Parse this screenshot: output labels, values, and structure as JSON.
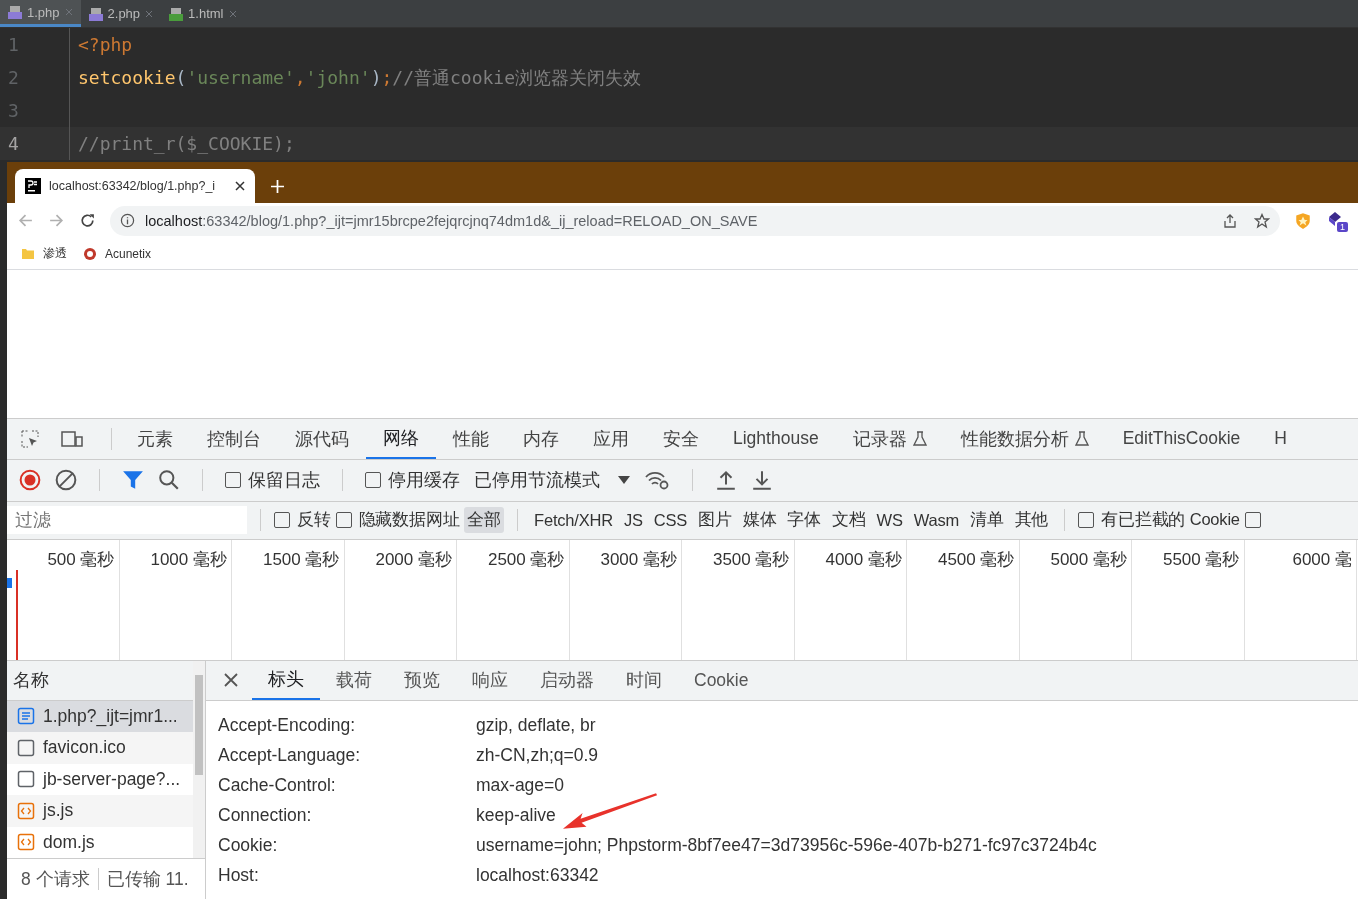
{
  "editor_tabs": [
    {
      "label": "1.php",
      "kind": "php",
      "selected": true
    },
    {
      "label": "2.php",
      "kind": "php",
      "selected": false
    },
    {
      "label": "1.html",
      "kind": "html",
      "selected": false
    }
  ],
  "code_lines": [
    {
      "number": "1",
      "current": false,
      "tokens": [
        {
          "kind": "keyword",
          "text": "<?php"
        }
      ]
    },
    {
      "number": "2",
      "current": false,
      "tokens": [
        {
          "kind": "function",
          "text": "setcookie"
        },
        {
          "kind": "punct",
          "text": "("
        },
        {
          "kind": "string",
          "text": "'username'"
        },
        {
          "kind": "keyword",
          "text": ","
        },
        {
          "kind": "string",
          "text": "'john'"
        },
        {
          "kind": "punct",
          "text": ")"
        },
        {
          "kind": "keyword",
          "text": ";"
        },
        {
          "kind": "comment",
          "text": "//普通cookie浏览器关闭失效"
        }
      ]
    },
    {
      "number": "3",
      "current": false
    },
    {
      "number": "4",
      "current": true,
      "tokens": [
        {
          "kind": "comment",
          "text": "//print_r($_COOKIE);"
        }
      ]
    }
  ],
  "browser": {
    "tab_title": "localhost:63342/blog/1.php?_i",
    "url_host": "localhost",
    "url_rest": ":63342/blog/1.php?_ijt=jmr15brcpe2fejqrcjnq74dm1d&_ij_reload=RELOAD_ON_SAVE",
    "extension_badge": "1",
    "bookmarks": [
      {
        "label": "渗透",
        "kind": "folder"
      },
      {
        "label": "Acunetix",
        "kind": "site"
      }
    ]
  },
  "devtools": {
    "tabs": [
      {
        "label": "元素",
        "selected": false
      },
      {
        "label": "控制台",
        "selected": false
      },
      {
        "label": "源代码",
        "selected": false
      },
      {
        "label": "网络",
        "selected": true
      },
      {
        "label": "性能",
        "selected": false
      },
      {
        "label": "内存",
        "selected": false
      },
      {
        "label": "应用",
        "selected": false
      },
      {
        "label": "安全",
        "selected": false
      },
      {
        "label": "Lighthouse",
        "selected": false
      },
      {
        "label": "记录器",
        "selected": false,
        "kind": "experiment"
      },
      {
        "label": "性能数据分析",
        "selected": false,
        "kind": "experiment"
      },
      {
        "label": "EditThisCookie",
        "selected": false
      },
      {
        "label": "H",
        "selected": false
      }
    ],
    "recording": true,
    "preserve_log": {
      "label": "保留日志",
      "checked": false
    },
    "disable_cache": {
      "label": "停用缓存",
      "checked": false
    },
    "throttling": "已停用节流模式",
    "filter": {
      "placeholder": "过滤"
    },
    "invert": {
      "label": "反转",
      "checked": false
    },
    "hide_data_urls": {
      "label": "隐藏数据网址",
      "checked": false
    },
    "types": [
      {
        "label": "全部",
        "selected": true
      },
      {
        "label": "Fetch/XHR",
        "selected": false
      },
      {
        "label": "JS",
        "selected": false
      },
      {
        "label": "CSS",
        "selected": false
      },
      {
        "label": "图片",
        "selected": false
      },
      {
        "label": "媒体",
        "selected": false
      },
      {
        "label": "字体",
        "selected": false
      },
      {
        "label": "文档",
        "selected": false
      },
      {
        "label": "WS",
        "selected": false
      },
      {
        "label": "Wasm",
        "selected": false
      },
      {
        "label": "清单",
        "selected": false
      },
      {
        "label": "其他",
        "selected": false
      }
    ],
    "blocked_cookies": {
      "label": "有已拦截的 Cookie",
      "checked": false
    },
    "extra_checkbox": {
      "checked": false
    },
    "timeline_ticks": [
      "500 毫秒",
      "1000 毫秒",
      "1500 毫秒",
      "2000 毫秒",
      "2500 毫秒",
      "3000 毫秒",
      "3500 毫秒",
      "4000 毫秒",
      "4500 毫秒",
      "5000 毫秒",
      "5500 毫秒",
      "6000 毫"
    ],
    "name_column": "名称",
    "requests": [
      {
        "name": "1.php?_ijt=jmr1...",
        "kind": "document",
        "selected": true
      },
      {
        "name": "favicon.ico",
        "kind": "other",
        "selected": false
      },
      {
        "name": "jb-server-page?...",
        "kind": "other",
        "selected": false
      },
      {
        "name": "js.js",
        "kind": "script",
        "selected": false
      },
      {
        "name": "dom.js",
        "kind": "script",
        "selected": false
      }
    ],
    "status": {
      "requests": "8 个请求",
      "transferred": "已传输 11."
    },
    "detail_tabs": [
      {
        "label": "标头",
        "selected": true
      },
      {
        "label": "载荷",
        "selected": false
      },
      {
        "label": "预览",
        "selected": false
      },
      {
        "label": "响应",
        "selected": false
      },
      {
        "label": "启动器",
        "selected": false
      },
      {
        "label": "时间",
        "selected": false
      },
      {
        "label": "Cookie",
        "selected": false
      }
    ],
    "headers": [
      {
        "name": "Accept-Encoding:",
        "value": "gzip, deflate, br"
      },
      {
        "name": "Accept-Language:",
        "value": "zh-CN,zh;q=0.9"
      },
      {
        "name": "Cache-Control:",
        "value": "max-age=0"
      },
      {
        "name": "Connection:",
        "value": "keep-alive"
      },
      {
        "name": "Cookie:",
        "value": "username=john; Phpstorm-8bf7ee47=3d73956c-596e-407b-b271-fc97c3724b4c"
      },
      {
        "name": "Host:",
        "value": "localhost:63342"
      }
    ]
  }
}
